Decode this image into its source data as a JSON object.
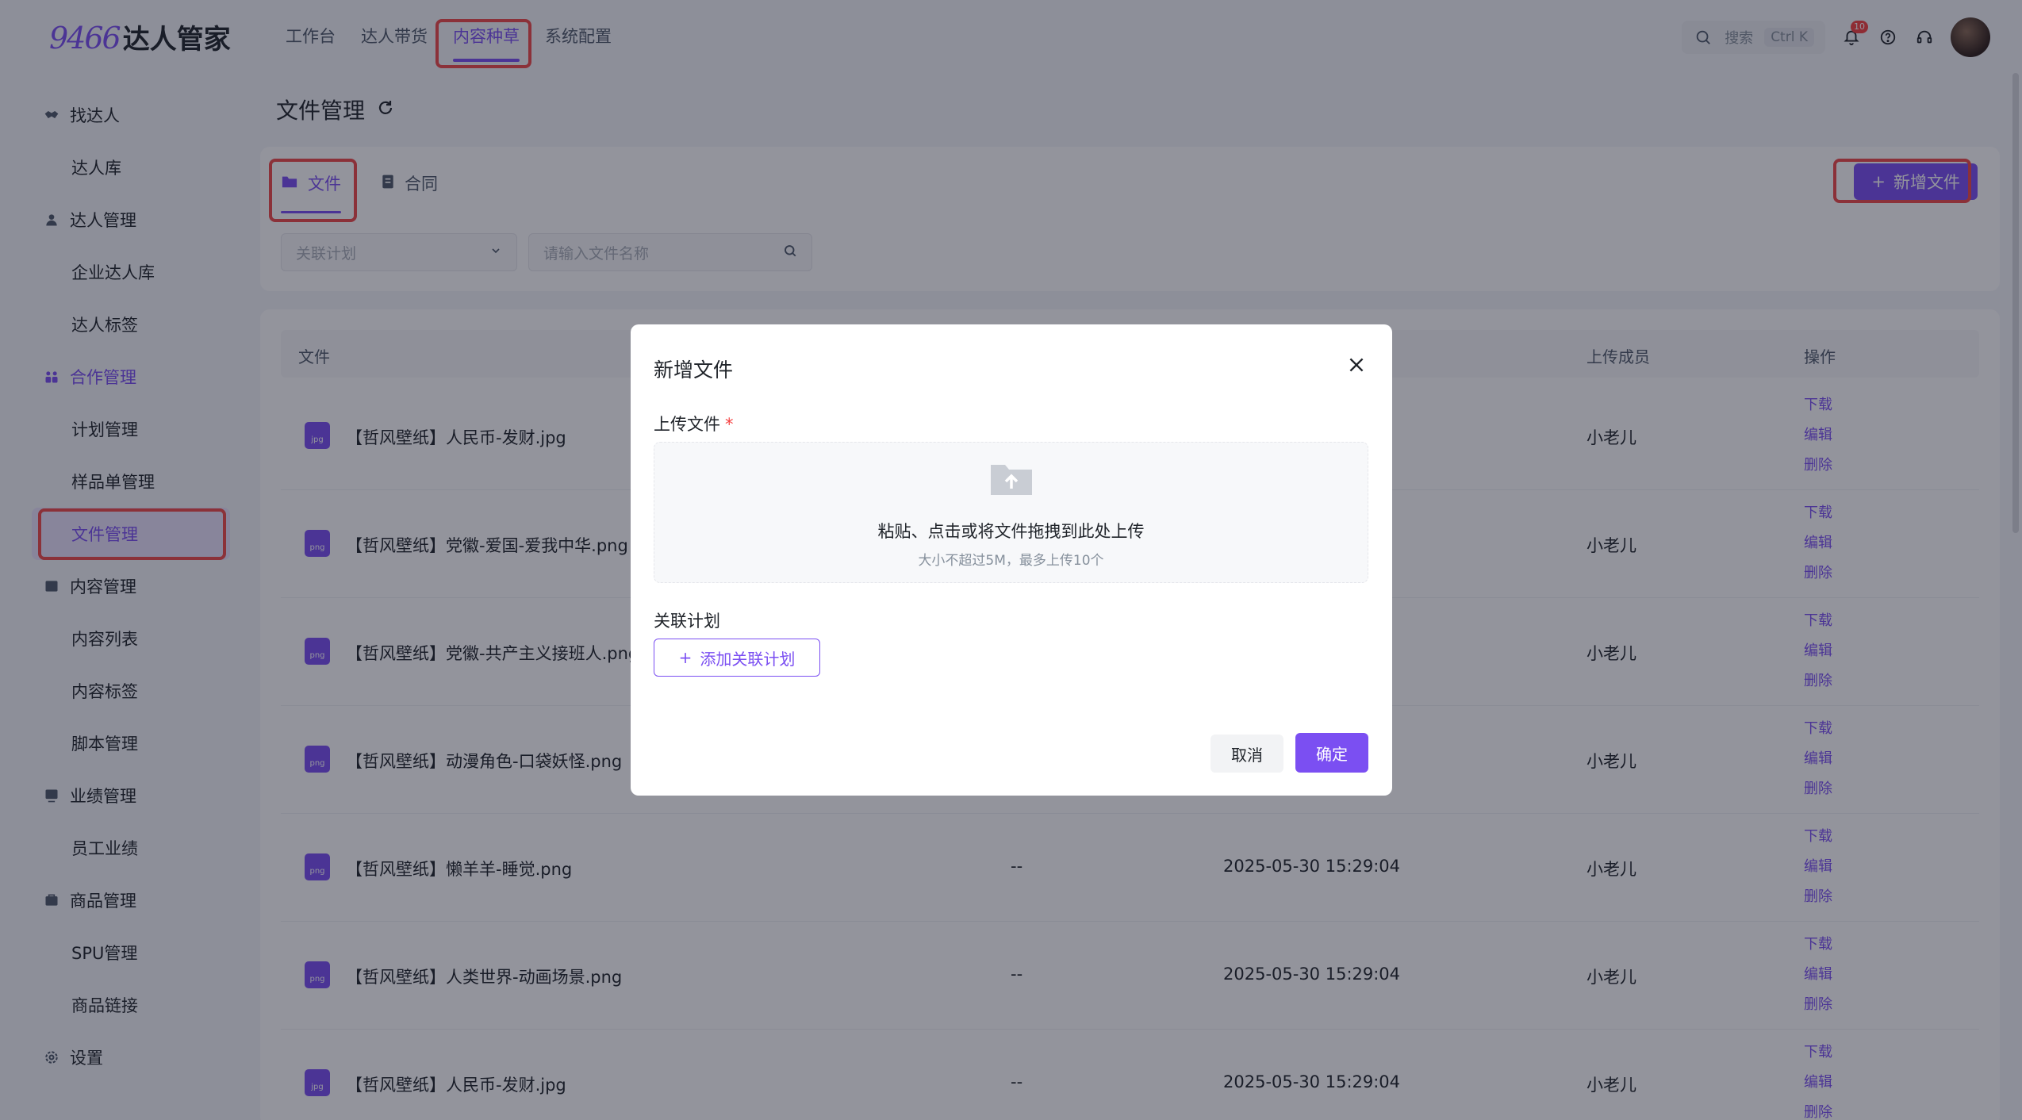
{
  "colors": {
    "accent": "#7b4ff2",
    "highlight": "#f04848",
    "overlay": "rgba(20,22,40,0.46)"
  },
  "logo": {
    "number": "9466",
    "name": "达人管家"
  },
  "nav": {
    "items": [
      {
        "label": "工作台",
        "active": false
      },
      {
        "label": "达人带货",
        "active": false
      },
      {
        "label": "内容种草",
        "active": true
      },
      {
        "label": "系统配置",
        "active": false
      }
    ]
  },
  "topright": {
    "search_label": "搜索",
    "shortcut": "Ctrl K",
    "notification_count": "10"
  },
  "sidebar": {
    "items": [
      {
        "type": "group",
        "label": "找达人",
        "icon": "handshake-icon"
      },
      {
        "type": "item",
        "label": "达人库"
      },
      {
        "type": "group",
        "label": "达人管理",
        "icon": "user-icon"
      },
      {
        "type": "item",
        "label": "企业达人库"
      },
      {
        "type": "item",
        "label": "达人标签"
      },
      {
        "type": "group",
        "label": "合作管理",
        "icon": "cooperation-icon"
      },
      {
        "type": "item",
        "label": "计划管理"
      },
      {
        "type": "item",
        "label": "样品单管理"
      },
      {
        "type": "item",
        "label": "文件管理",
        "active": true
      },
      {
        "type": "group",
        "label": "内容管理",
        "icon": "content-icon"
      },
      {
        "type": "item",
        "label": "内容列表"
      },
      {
        "type": "item",
        "label": "内容标签"
      },
      {
        "type": "item",
        "label": "脚本管理"
      },
      {
        "type": "group",
        "label": "业绩管理",
        "icon": "chart-icon"
      },
      {
        "type": "item",
        "label": "员工业绩"
      },
      {
        "type": "group",
        "label": "商品管理",
        "icon": "product-icon"
      },
      {
        "type": "item",
        "label": "SPU管理"
      },
      {
        "type": "item",
        "label": "商品链接"
      },
      {
        "type": "group",
        "label": "设置",
        "icon": "gear-icon"
      }
    ]
  },
  "page": {
    "title": "文件管理"
  },
  "filter": {
    "tabs": [
      {
        "label": "文件",
        "icon": "folder-icon",
        "active": true
      },
      {
        "label": "合同",
        "icon": "contract-icon",
        "active": false
      }
    ],
    "add_button": "新增文件",
    "plan_placeholder": "关联计划",
    "search_placeholder": "请输入文件名称"
  },
  "table": {
    "headers": {
      "file": "文件",
      "uploader": "上传成员",
      "actions": "操作"
    },
    "actions": [
      "下载",
      "编辑",
      "删除"
    ],
    "rows": [
      {
        "type": "jpg",
        "name": "【哲风壁纸】人民币-发财.jpg",
        "plan": "",
        "time": "",
        "owner": "小老儿"
      },
      {
        "type": "png",
        "name": "【哲风壁纸】党徽-爱国-爱我中华.png",
        "plan": "",
        "time": "",
        "owner": "小老儿"
      },
      {
        "type": "png",
        "name": "【哲风壁纸】党徽-共产主义接班人.png",
        "plan": "",
        "time": "",
        "owner": "小老儿"
      },
      {
        "type": "png",
        "name": "【哲风壁纸】动漫角色-口袋妖怪.png",
        "plan": "",
        "time": "",
        "owner": "小老儿"
      },
      {
        "type": "png",
        "name": "【哲风壁纸】懒羊羊-睡觉.png",
        "plan": "--",
        "time": "2025-05-30 15:29:04",
        "owner": "小老儿"
      },
      {
        "type": "png",
        "name": "【哲风壁纸】人类世界-动画场景.png",
        "plan": "--",
        "time": "2025-05-30 15:29:04",
        "owner": "小老儿"
      },
      {
        "type": "jpg",
        "name": "【哲风壁纸】人民币-发财.jpg",
        "plan": "--",
        "time": "2025-05-30 15:29:04",
        "owner": "小老儿"
      }
    ]
  },
  "modal": {
    "title": "新增文件",
    "upload_label": "上传文件",
    "required_mark": "*",
    "dropzone_main": "粘贴、点击或将文件拖拽到此处上传",
    "dropzone_sub": "大小不超过5M，最多上传10个",
    "plan_label": "关联计划",
    "add_plan_button": "添加关联计划",
    "cancel": "取消",
    "confirm": "确定"
  }
}
